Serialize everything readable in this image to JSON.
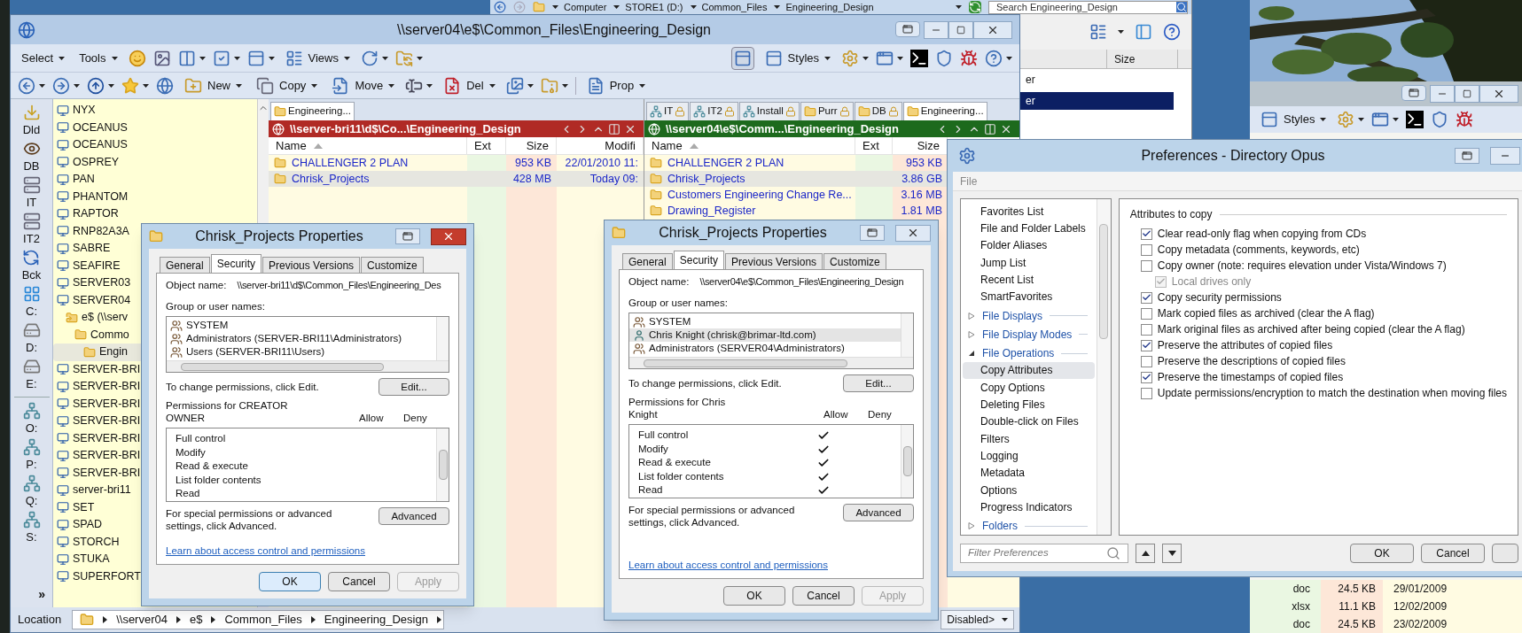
{
  "explorer": {
    "breadcrumb": [
      "Computer",
      "STORE1 (D:)",
      "Common_Files",
      "Engineering_Design"
    ],
    "search": {
      "placeholder": "Search Engineering_Design"
    },
    "column": "Size",
    "rows": [
      {
        "name": "er",
        "selected": false
      },
      {
        "name": "er",
        "selected": true
      }
    ]
  },
  "back_window": {
    "toolbar_label": "Styles",
    "rows": [
      {
        "ext": "doc",
        "size": "24.5 KB",
        "modified": "29/01/2009"
      },
      {
        "ext": "xlsx",
        "size": "11.1 KB",
        "modified": "12/02/2009"
      },
      {
        "ext": "doc",
        "size": "24.5 KB",
        "modified": "23/02/2009"
      }
    ]
  },
  "main_window": {
    "title": "\\\\server04\\e$\\Common_Files\\Engineering_Design",
    "toolbar_top": [
      "Select",
      "Tools",
      "Views",
      "Styles"
    ],
    "toolbar_bottom": [
      "New",
      "Copy",
      "Move",
      "Del",
      "Prop"
    ],
    "sidebar": [
      {
        "label": "Dld",
        "kind": "download"
      },
      {
        "label": "DB",
        "kind": "eye"
      },
      {
        "label": "IT",
        "kind": "server"
      },
      {
        "label": "IT2",
        "kind": "server"
      },
      {
        "label": "Bck",
        "kind": "sync"
      },
      {
        "label": "C:",
        "kind": "windows"
      },
      {
        "label": "D:",
        "kind": "drive"
      },
      {
        "label": "E:",
        "kind": "drive"
      },
      {
        "label": "O:",
        "kind": "netdrive"
      },
      {
        "label": "P:",
        "kind": "netdrive"
      },
      {
        "label": "Q:",
        "kind": "netdrive"
      },
      {
        "label": "S:",
        "kind": "netdrive"
      }
    ],
    "sidebar_more": "»",
    "tree": [
      {
        "label": "NYX",
        "kind": "computer",
        "selected": false
      },
      {
        "label": "OCEANUS",
        "kind": "computer",
        "selected": false
      },
      {
        "label": "OCEANUS",
        "kind": "computer",
        "selected": false
      },
      {
        "label": "OSPREY",
        "kind": "computer",
        "selected": false
      },
      {
        "label": "PAN",
        "kind": "computer",
        "selected": false
      },
      {
        "label": "PHANTOM",
        "kind": "computer",
        "selected": false
      },
      {
        "label": "RAPTOR",
        "kind": "computer",
        "selected": false
      },
      {
        "label": "RNP82A3A",
        "kind": "computer",
        "selected": false
      },
      {
        "label": "SABRE",
        "kind": "computer",
        "selected": false
      },
      {
        "label": "SEAFIRE",
        "kind": "computer",
        "selected": false
      },
      {
        "label": "SERVER03",
        "kind": "computer",
        "selected": false
      },
      {
        "label": "SERVER04",
        "kind": "computer",
        "selected": false,
        "children": [
          {
            "label": "e$ (\\\\serv",
            "kind": "share",
            "selected": false,
            "children": [
              {
                "label": "Commo",
                "kind": "folder",
                "selected": false,
                "children": [
                  {
                    "label": "Engin",
                    "kind": "folder",
                    "selected": true
                  }
                ]
              }
            ]
          }
        ]
      },
      {
        "label": "SERVER-BRI",
        "kind": "computer",
        "selected": false
      },
      {
        "label": "SERVER-BRI",
        "kind": "computer",
        "selected": false
      },
      {
        "label": "SERVER-BRI",
        "kind": "computer",
        "selected": false
      },
      {
        "label": "SERVER-BRI",
        "kind": "computer",
        "selected": false
      },
      {
        "label": "SERVER-BRI",
        "kind": "computer",
        "selected": false
      },
      {
        "label": "SERVER-BRI",
        "kind": "computer",
        "selected": false
      },
      {
        "label": "SERVER-BRI",
        "kind": "computer",
        "selected": false
      },
      {
        "label": "server-bri11",
        "kind": "computer",
        "selected": false
      },
      {
        "label": "SET",
        "kind": "computer",
        "selected": false
      },
      {
        "label": "SPAD",
        "kind": "computer",
        "selected": false
      },
      {
        "label": "STORCH",
        "kind": "computer",
        "selected": false
      },
      {
        "label": "STUKA",
        "kind": "computer",
        "selected": false
      },
      {
        "label": "SUPERFORT",
        "kind": "computer",
        "selected": false
      }
    ],
    "listers": [
      {
        "color": "#b02a25",
        "path": "\\\\server-bri11\\d$\\Co...\\Engineering_Design",
        "tabs": [
          {
            "label": "Engineering...",
            "kind": "folder",
            "locked": false,
            "selected": true
          }
        ],
        "columns": [
          "Name",
          "Ext",
          "Size",
          "Modifi"
        ],
        "rows": [
          {
            "name": "CHALLENGER 2 PLAN",
            "size": "953 KB",
            "modified": "22/01/2010  11:",
            "selected": false
          },
          {
            "name": "Chrisk_Projects",
            "size": "428 MB",
            "modified": "Today  09:",
            "selected": true
          }
        ]
      },
      {
        "color": "#1d6a1d",
        "path": "\\\\server04\\e$\\Comm...\\Engineering_Design",
        "tabs": [
          {
            "label": "IT",
            "kind": "network",
            "locked": true,
            "selected": false
          },
          {
            "label": "IT2",
            "kind": "network",
            "locked": true,
            "selected": false
          },
          {
            "label": "Install",
            "kind": "network",
            "locked": true,
            "selected": false
          },
          {
            "label": "Purr",
            "kind": "folder",
            "locked": true,
            "selected": false
          },
          {
            "label": "DB",
            "kind": "folder",
            "locked": true,
            "selected": false
          },
          {
            "label": "Engineering...",
            "kind": "folder",
            "locked": false,
            "selected": true
          }
        ],
        "columns": [
          "Name",
          "Ext",
          "Size"
        ],
        "rows": [
          {
            "name": "CHALLENGER 2 PLAN",
            "size": "953 KB",
            "selected": false
          },
          {
            "name": "Chrisk_Projects",
            "size": "3.86 GB",
            "selected": true
          },
          {
            "name": "Customers Engineering Change Re...",
            "size": "3.16 MB",
            "selected": false
          },
          {
            "name": "Drawing_Register",
            "size": "1.81 MB",
            "selected": false
          }
        ]
      }
    ],
    "location": {
      "label": "Location",
      "crumbs": [
        "\\\\server04",
        "e$",
        "Common_Files",
        "Engineering_Design"
      ]
    },
    "status_dropdown": "Disabled>"
  },
  "dialogs": [
    {
      "title": "Chrisk_Projects Properties",
      "tabs": [
        {
          "label": "General",
          "selected": false
        },
        {
          "label": "Security",
          "selected": true
        },
        {
          "label": "Previous Versions",
          "selected": false
        },
        {
          "label": "Customize",
          "selected": false
        }
      ],
      "object_label": "Object name:",
      "object_name": "\\\\server-bri11\\d$\\Common_Files\\Engineering_Des",
      "group_label": "Group or user names:",
      "users": [
        {
          "name": "SYSTEM",
          "kind": "group",
          "selected": false
        },
        {
          "name": "Administrators (SERVER-BRI11\\Administrators)",
          "kind": "group",
          "selected": false
        },
        {
          "name": "Users (SERVER-BRI11\\Users)",
          "kind": "group",
          "selected": false
        }
      ],
      "change_text": "To change permissions, click Edit.",
      "edit_button": "Edit...",
      "permissions_label": "Permissions for CREATOR OWNER",
      "allow_label": "Allow",
      "deny_label": "Deny",
      "permissions": [
        {
          "name": "Full control",
          "allow": false,
          "deny": false
        },
        {
          "name": "Modify",
          "allow": false,
          "deny": false
        },
        {
          "name": "Read & execute",
          "allow": false,
          "deny": false
        },
        {
          "name": "List folder contents",
          "allow": false,
          "deny": false
        },
        {
          "name": "Read",
          "allow": false,
          "deny": false
        }
      ],
      "advanced_text": "For special permissions or advanced settings, click Advanced.",
      "advanced_button": "Advanced",
      "link": "Learn about access control and permissions",
      "buttons": [
        {
          "label": "OK",
          "default": true,
          "disabled": false
        },
        {
          "label": "Cancel",
          "default": false,
          "disabled": false
        },
        {
          "label": "Apply",
          "default": false,
          "disabled": true
        }
      ]
    },
    {
      "title": "Chrisk_Projects Properties",
      "tabs": [
        {
          "label": "General",
          "selected": false
        },
        {
          "label": "Security",
          "selected": true
        },
        {
          "label": "Previous Versions",
          "selected": false
        },
        {
          "label": "Customize",
          "selected": false
        }
      ],
      "object_label": "Object name:",
      "object_name": "\\\\server04\\e$\\Common_Files\\Engineering_Design",
      "group_label": "Group or user names:",
      "users": [
        {
          "name": "SYSTEM",
          "kind": "group",
          "selected": false
        },
        {
          "name": "Chris Knight (chrisk@brimar-ltd.com)",
          "kind": "user",
          "selected": true
        },
        {
          "name": "Administrators (SERVER04\\Administrators)",
          "kind": "group",
          "selected": false
        }
      ],
      "change_text": "To change permissions, click Edit.",
      "edit_button": "Edit...",
      "permissions_label": "Permissions for Chris Knight",
      "allow_label": "Allow",
      "deny_label": "Deny",
      "permissions": [
        {
          "name": "Full control",
          "allow": true,
          "deny": false
        },
        {
          "name": "Modify",
          "allow": true,
          "deny": false
        },
        {
          "name": "Read & execute",
          "allow": true,
          "deny": false
        },
        {
          "name": "List folder contents",
          "allow": true,
          "deny": false
        },
        {
          "name": "Read",
          "allow": true,
          "deny": false
        }
      ],
      "advanced_text": "For special permissions or advanced settings, click Advanced.",
      "advanced_button": "Advanced",
      "link": "Learn about access control and permissions",
      "buttons": [
        {
          "label": "OK",
          "default": false,
          "disabled": false
        },
        {
          "label": "Cancel",
          "default": false,
          "disabled": false
        },
        {
          "label": "Apply",
          "default": false,
          "disabled": true
        }
      ]
    }
  ],
  "preferences": {
    "title": "Preferences - Directory Opus",
    "menu": [
      "File"
    ],
    "nav": [
      {
        "label": "Favorites List",
        "kind": "page",
        "selected": false
      },
      {
        "label": "File and Folder Labels",
        "kind": "page",
        "selected": false
      },
      {
        "label": "Folder Aliases",
        "kind": "page",
        "selected": false
      },
      {
        "label": "Jump List",
        "kind": "page",
        "selected": false
      },
      {
        "label": "Recent List",
        "kind": "page",
        "selected": false
      },
      {
        "label": "SmartFavorites",
        "kind": "page",
        "selected": false
      },
      {
        "label": "File Displays",
        "kind": "section",
        "expanded": false,
        "selected": false
      },
      {
        "label": "File Display Modes",
        "kind": "section",
        "expanded": false,
        "selected": false
      },
      {
        "label": "File Operations",
        "kind": "section",
        "expanded": true,
        "selected": false,
        "children": [
          {
            "label": "Copy Attributes",
            "kind": "page",
            "selected": true
          },
          {
            "label": "Copy Options",
            "kind": "page",
            "selected": false
          },
          {
            "label": "Deleting Files",
            "kind": "page",
            "selected": false
          },
          {
            "label": "Double-click on Files",
            "kind": "page",
            "selected": false
          },
          {
            "label": "Filters",
            "kind": "page",
            "selected": false
          },
          {
            "label": "Logging",
            "kind": "page",
            "selected": false
          },
          {
            "label": "Metadata",
            "kind": "page",
            "selected": false
          },
          {
            "label": "Options",
            "kind": "page",
            "selected": false
          },
          {
            "label": "Progress Indicators",
            "kind": "page",
            "selected": false
          }
        ]
      },
      {
        "label": "Folders",
        "kind": "section",
        "expanded": false,
        "selected": false
      }
    ],
    "group_title": "Attributes to copy",
    "options": [
      {
        "label": "Clear read-only flag when copying from CDs",
        "checked": true,
        "disabled": false
      },
      {
        "label": "Copy metadata (comments, keywords, etc)",
        "checked": false,
        "disabled": false
      },
      {
        "label": "Copy owner (note: requires elevation under Vista/Windows 7)",
        "checked": false,
        "disabled": false,
        "children": [
          {
            "label": "Local drives only",
            "checked": true,
            "disabled": true
          }
        ]
      },
      {
        "label": "Copy security permissions",
        "checked": true,
        "disabled": false
      },
      {
        "label": "Mark copied files as archived (clear the A flag)",
        "checked": false,
        "disabled": false
      },
      {
        "label": "Mark original files as archived after being copied (clear the A flag)",
        "checked": false,
        "disabled": false
      },
      {
        "label": "Preserve the attributes of copied files",
        "checked": true,
        "disabled": false
      },
      {
        "label": "Preserve the descriptions of copied files",
        "checked": false,
        "disabled": false
      },
      {
        "label": "Preserve the timestamps of copied files",
        "checked": true,
        "disabled": false
      },
      {
        "label": "Update permissions/encryption to match the destination when moving files",
        "checked": false,
        "disabled": false
      }
    ],
    "filter": {
      "placeholder": "Filter Preferences"
    },
    "buttons": [
      "OK",
      "Cancel"
    ]
  }
}
